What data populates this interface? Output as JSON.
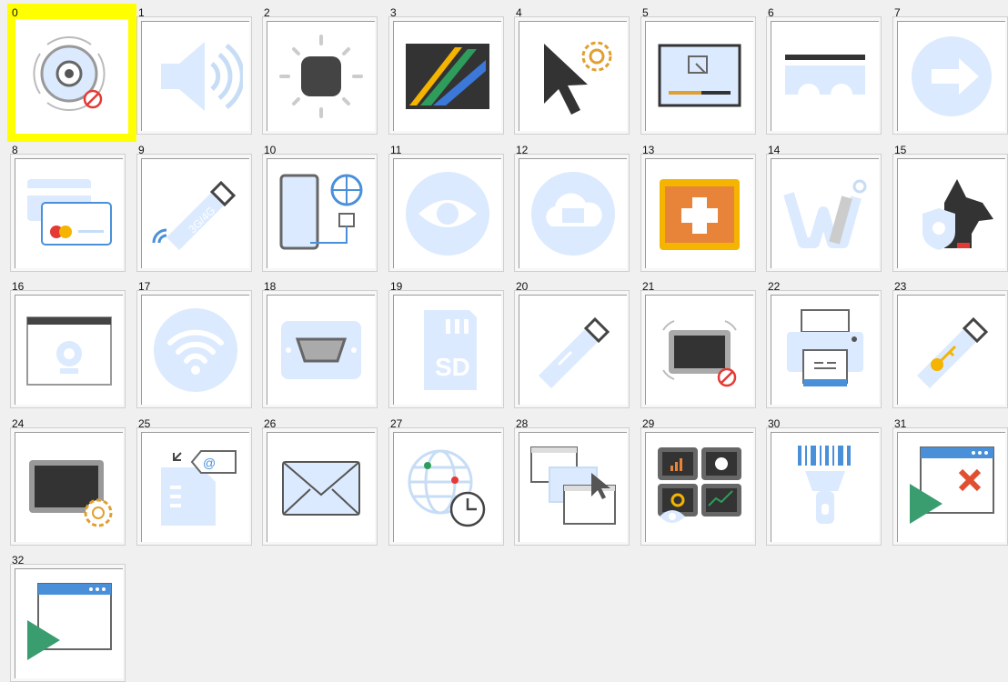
{
  "selected_index": 0,
  "colors": {
    "highlight": "#ffff00",
    "light_blue": "#dbeafe",
    "dark": "#444444",
    "blue": "#4a90d9",
    "orange": "#e78a2f"
  },
  "items": [
    {
      "label": "0",
      "icon": "disc-blocked-icon"
    },
    {
      "label": "1",
      "icon": "speaker-icon"
    },
    {
      "label": "2",
      "icon": "brightness-icon"
    },
    {
      "label": "3",
      "icon": "wallpaper-icon"
    },
    {
      "label": "4",
      "icon": "mouse-settings-icon"
    },
    {
      "label": "5",
      "icon": "screen-capture-icon"
    },
    {
      "label": "6",
      "icon": "bridge-icon"
    },
    {
      "label": "7",
      "icon": "transfer-icon"
    },
    {
      "label": "8",
      "icon": "credit-cards-icon"
    },
    {
      "label": "9",
      "icon": "usb-modem-icon"
    },
    {
      "label": "10",
      "icon": "phone-internet-icon"
    },
    {
      "label": "11",
      "icon": "eye-icon"
    },
    {
      "label": "12",
      "icon": "cloud-screen-icon"
    },
    {
      "label": "13",
      "icon": "first-aid-icon"
    },
    {
      "label": "14",
      "icon": "w-logo-icon"
    },
    {
      "label": "15",
      "icon": "watchdog-icon"
    },
    {
      "label": "16",
      "icon": "browser-webcam-icon"
    },
    {
      "label": "17",
      "icon": "wifi-icon"
    },
    {
      "label": "18",
      "icon": "serial-port-icon"
    },
    {
      "label": "19",
      "icon": "sd-card-icon"
    },
    {
      "label": "20",
      "icon": "usb-drive-icon"
    },
    {
      "label": "21",
      "icon": "tablet-blocked-icon"
    },
    {
      "label": "22",
      "icon": "printer-icon"
    },
    {
      "label": "23",
      "icon": "usb-key-icon"
    },
    {
      "label": "24",
      "icon": "tablet-settings-icon"
    },
    {
      "label": "25",
      "icon": "sim-email-icon"
    },
    {
      "label": "26",
      "icon": "envelope-icon"
    },
    {
      "label": "27",
      "icon": "globe-clock-icon"
    },
    {
      "label": "28",
      "icon": "windows-cursor-icon"
    },
    {
      "label": "29",
      "icon": "dashboard-monitor-icon"
    },
    {
      "label": "30",
      "icon": "barcode-scanner-icon"
    },
    {
      "label": "31",
      "icon": "close-app-icon"
    },
    {
      "label": "32",
      "icon": "launch-app-icon"
    }
  ]
}
